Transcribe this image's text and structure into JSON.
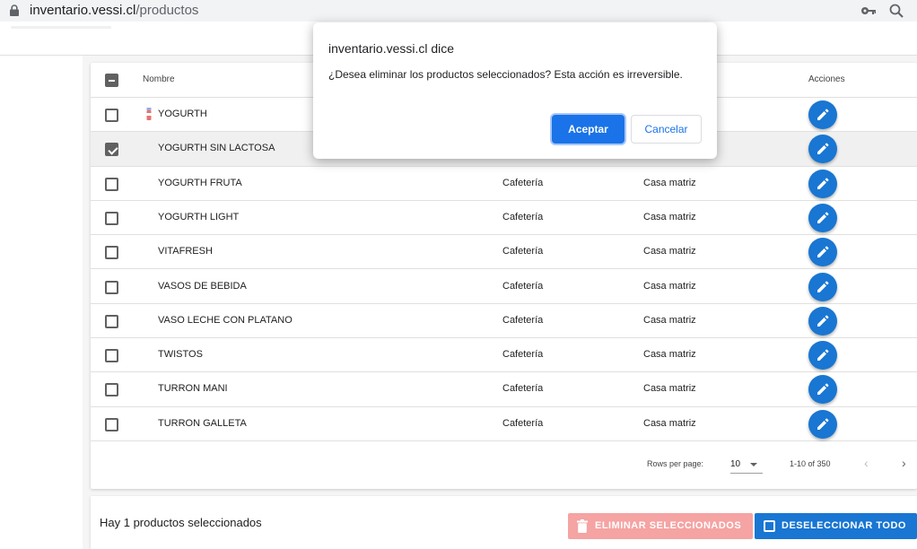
{
  "browser": {
    "url_host": "inventario.vessi.cl",
    "url_path": "/productos"
  },
  "table": {
    "headers": {
      "name": "Nombre",
      "actions": "Acciones"
    },
    "rows": [
      {
        "name": "YOGURTH",
        "category": "",
        "location": "",
        "checked": false,
        "has_icon": true
      },
      {
        "name": "YOGURTH SIN LACTOSA",
        "category": "",
        "location": "",
        "checked": true,
        "has_icon": false
      },
      {
        "name": "YOGURTH FRUTA",
        "category": "Cafetería",
        "location": "Casa matriz",
        "checked": false,
        "has_icon": false
      },
      {
        "name": "YOGURTH LIGHT",
        "category": "Cafetería",
        "location": "Casa matriz",
        "checked": false,
        "has_icon": false
      },
      {
        "name": "VITAFRESH",
        "category": "Cafetería",
        "location": "Casa matriz",
        "checked": false,
        "has_icon": false
      },
      {
        "name": "VASOS DE BEBIDA",
        "category": "Cafetería",
        "location": "Casa matriz",
        "checked": false,
        "has_icon": false
      },
      {
        "name": "VASO LECHE CON PLATANO",
        "category": "Cafetería",
        "location": "Casa matriz",
        "checked": false,
        "has_icon": false
      },
      {
        "name": "TWISTOS",
        "category": "Cafetería",
        "location": "Casa matriz",
        "checked": false,
        "has_icon": false
      },
      {
        "name": "TURRON MANI",
        "category": "Cafetería",
        "location": "Casa matriz",
        "checked": false,
        "has_icon": false
      },
      {
        "name": "TURRON GALLETA",
        "category": "Cafetería",
        "location": "Casa matriz",
        "checked": false,
        "has_icon": false
      }
    ]
  },
  "pagination": {
    "rows_per_page_label": "Rows per page:",
    "rows_per_page": "10",
    "range": "1-10 of 350",
    "prev": "‹",
    "next": "›"
  },
  "selection_bar": {
    "message": "Hay 1 productos seleccionados",
    "delete_label": "ELIMINAR SELECCIONADOS",
    "deselect_label": "DESELECCIONAR TODO"
  },
  "dialog": {
    "title": "inventario.vessi.cl dice",
    "message": "¿Desea eliminar los productos seleccionados? Esta acción es irreversible.",
    "accept": "Aceptar",
    "cancel": "Cancelar"
  },
  "colors": {
    "primary": "#1976d2",
    "delete_disabled": "#f5a3a3",
    "dialog_accept": "#1a73e8"
  }
}
